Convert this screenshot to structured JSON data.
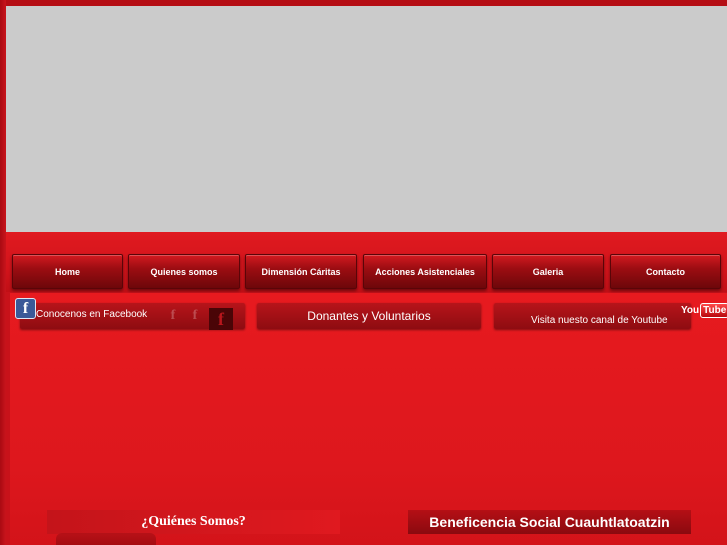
{
  "nav": {
    "items": [
      {
        "label": "Home"
      },
      {
        "label": "Quienes somos"
      },
      {
        "label": "Dimensión Cáritas"
      },
      {
        "label": "Acciones Asistenciales"
      },
      {
        "label": "Galeria"
      },
      {
        "label": "Contacto"
      }
    ]
  },
  "social": {
    "facebook_label": "Conocenos en Facebook",
    "facebook_icon_glyph": "f",
    "donors_label": "Donantes y Voluntarios",
    "youtube_label": "Visita nuesto canal de Youtube",
    "youtube_logo_you": "You",
    "youtube_logo_tube": "Tube"
  },
  "sections": {
    "about_heading": "¿Quiénes Somos?",
    "org_heading": "Beneficencia Social Cuauhtlatoatzin"
  },
  "colors": {
    "page_red": "#c8121a",
    "banner_gray": "#cbcbcb",
    "facebook_blue": "#3b5998"
  }
}
